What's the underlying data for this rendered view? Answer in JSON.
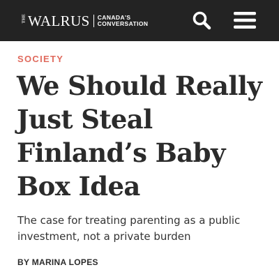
{
  "header": {
    "logo_the": "THE",
    "logo_name": "WALRUS",
    "tagline_line1": "CANADA'S",
    "tagline_line2": "CONVERSATION",
    "background_color": "#232323",
    "search_icon": "search-icon",
    "menu_icon": "hamburger-menu-icon"
  },
  "article": {
    "section": "SOCIETY",
    "section_color": "#e06a5d",
    "title": "We Should Really Just Steal Finland’s Baby Box Idea",
    "dek": "The case for treating parenting as a public investment, not a private burden",
    "byline_prefix": "BY ",
    "author": "MARINA LOPES"
  }
}
